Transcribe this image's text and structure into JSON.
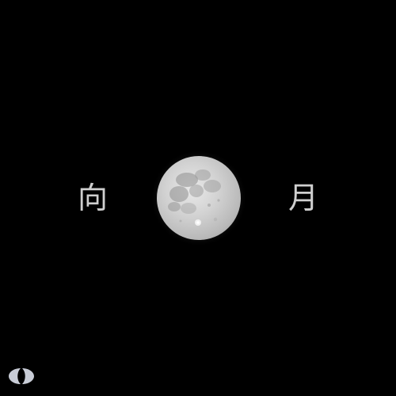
{
  "title": {
    "left_char": "向",
    "right_char": "月"
  },
  "image": {
    "subject": "full-moon",
    "background_color": "#000000",
    "text_color": "#cfcfcf"
  },
  "logo": {
    "icon": "logo-icon",
    "color": "#c8ccd6"
  }
}
